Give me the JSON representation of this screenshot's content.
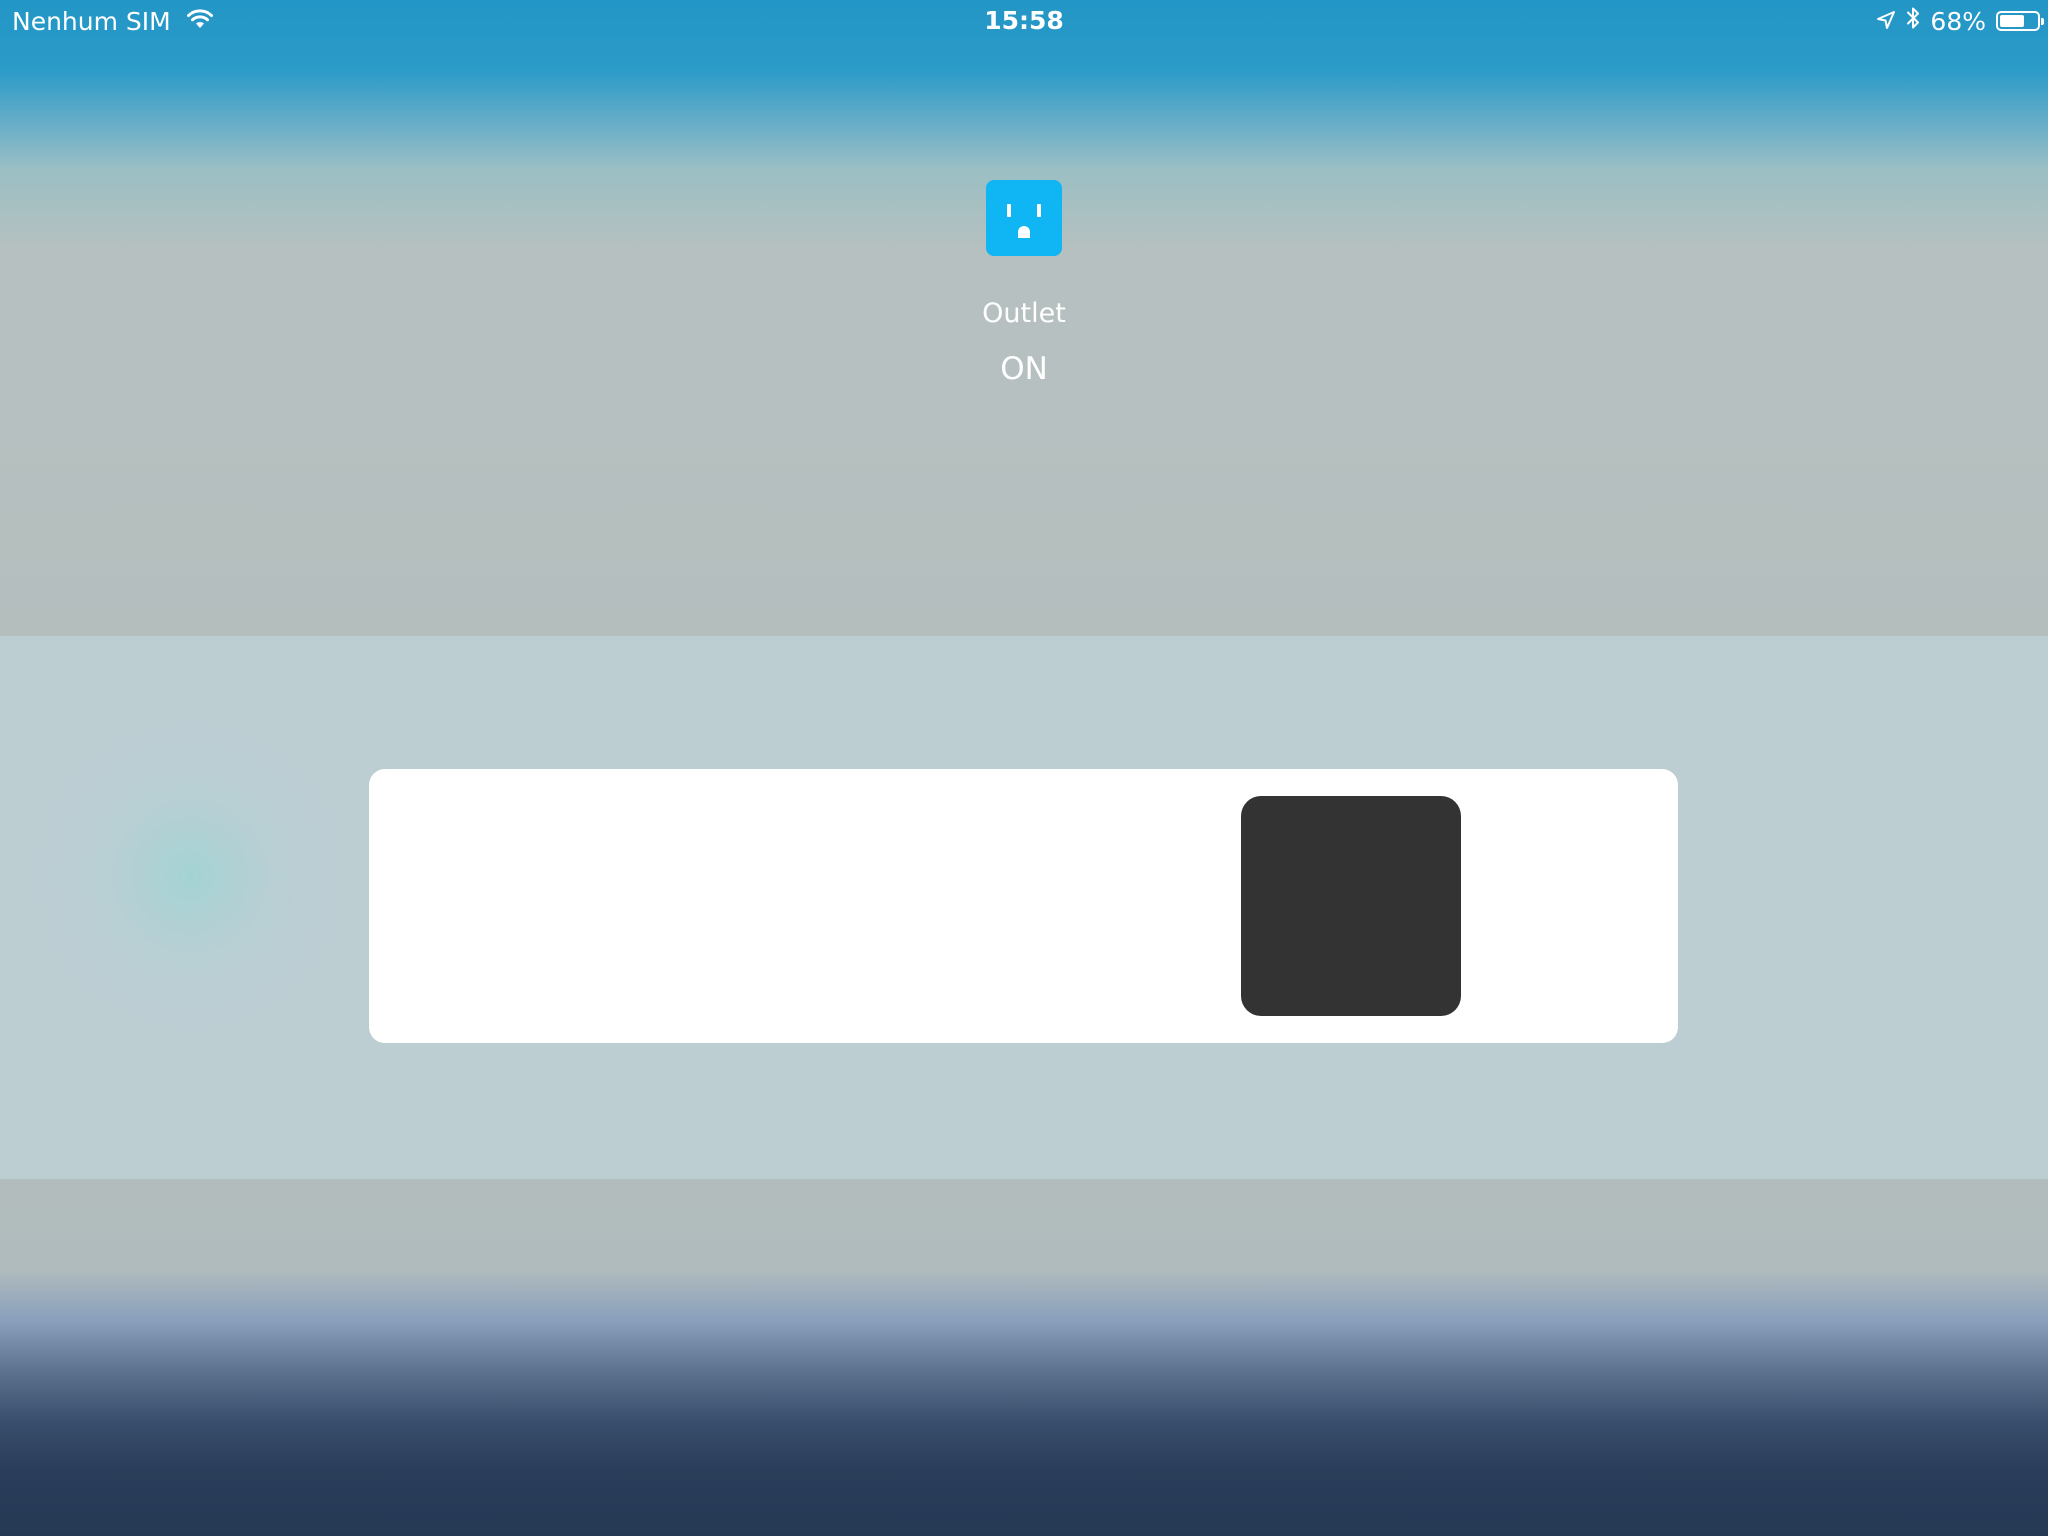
{
  "status_bar": {
    "carrier": "Nenhum SIM",
    "time": "15:58",
    "battery": "68%",
    "battery_level": 0.68,
    "icons": [
      "wifi-icon",
      "location-arrow-icon",
      "bluetooth-icon",
      "battery-icon"
    ]
  },
  "accessory": {
    "icon": "outlet-icon",
    "icon_color": "#10b6f3",
    "name": "Outlet",
    "state": "ON"
  },
  "power_switch": {
    "is_on": true,
    "track_color": "#ffffff",
    "thumb_color": "#333333"
  }
}
